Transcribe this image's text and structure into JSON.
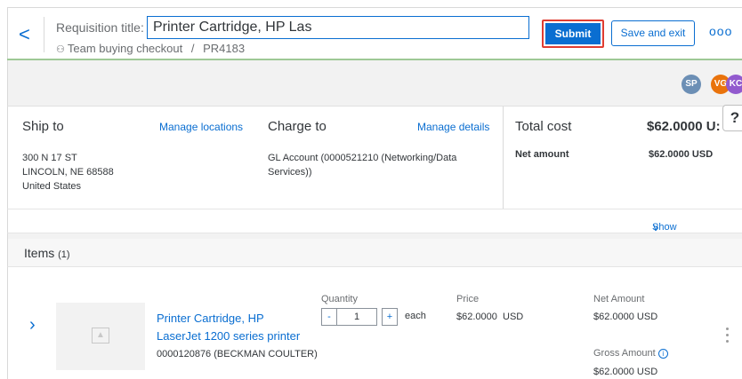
{
  "header": {
    "back_glyph": "<",
    "requisition_label": "Requisition title:",
    "required_star": "*",
    "title_value": "Printer Cartridge, HP Las",
    "breadcrumb_first": "Team buying checkout",
    "breadcrumb_sep": "/",
    "breadcrumb_second": "PR4183",
    "submit_label": "Submit",
    "save_exit_label": "Save and exit",
    "more_glyph": "ooo"
  },
  "avatars": [
    {
      "initials": "SP",
      "color": "#6c8fb5"
    },
    {
      "initials": "VG",
      "color": "#e9730c"
    },
    {
      "initials": "KC",
      "color": "#925ace"
    }
  ],
  "summary": {
    "ship_to": {
      "title": "Ship to",
      "link": "Manage locations",
      "address_line1": "300 N 17 ST",
      "address_line2": "LINCOLN, NE  68588",
      "address_line3": "United States"
    },
    "charge_to": {
      "title": "Charge to",
      "link": "Manage details",
      "account_line1": "GL Account (0000521210 (Networking/Data",
      "account_line2": "Services))"
    },
    "total": {
      "title": "Total cost",
      "value": "$62.0000 U:",
      "net_label": "Net amount",
      "net_value": "$62.0000 USD"
    },
    "help_glyph": "?",
    "show_details": "Show additional details"
  },
  "items": {
    "title": "Items",
    "count": "(1)",
    "list": [
      {
        "name": "Printer Cartridge, HP LaserJet 1200 series printer",
        "name_line1": "Printer Cartridge, HP",
        "name_line2": "LaserJet 1200 series printer",
        "code": "0000120876 (BECKMAN COULTER)",
        "quantity_label": "Quantity",
        "minus": "-",
        "quantity": "1",
        "plus": "+",
        "unit": "each",
        "price_label": "Price",
        "price": "$62.0000",
        "price_currency": "USD",
        "net_label": "Net Amount",
        "net_value": "$62.0000  USD",
        "gross_label": "Gross Amount",
        "gross_value": "$62.0000  USD"
      }
    ]
  }
}
